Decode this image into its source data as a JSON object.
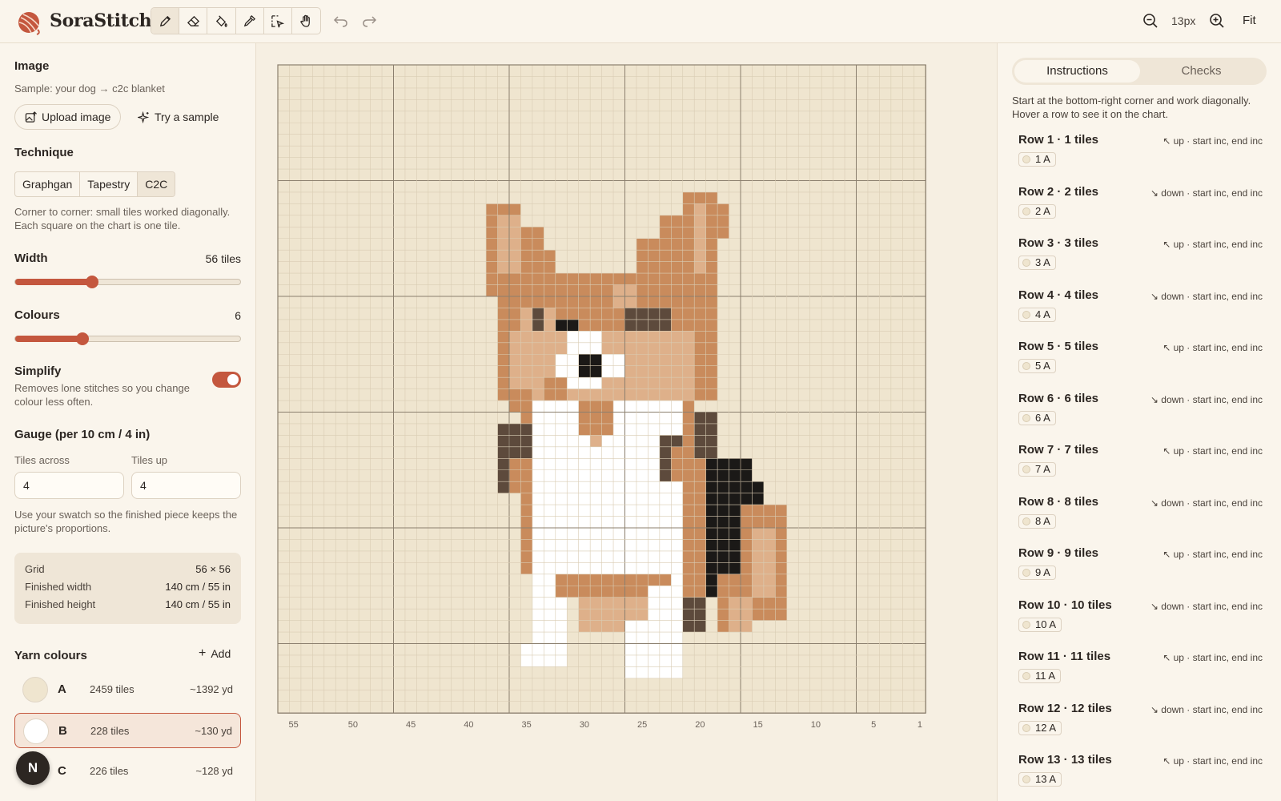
{
  "app": {
    "name": "SoraStitch",
    "logo_icon": "yarn-ball-icon"
  },
  "toolbar": {
    "tools": [
      {
        "name": "pencil-icon",
        "active": true
      },
      {
        "name": "eraser-icon",
        "active": false
      },
      {
        "name": "fill-bucket-icon",
        "active": false
      },
      {
        "name": "eyedropper-icon",
        "active": false
      },
      {
        "name": "select-icon",
        "active": false
      },
      {
        "name": "hand-icon",
        "active": false
      }
    ],
    "undo_icon": "undo-icon",
    "redo_icon": "redo-icon",
    "zoom_value": "13px",
    "fit_label": "Fit"
  },
  "sidebar": {
    "image": {
      "heading": "Image",
      "subtitle": "Sample: your dog → c2c blanket",
      "upload_label": "Upload image",
      "sample_label": "Try a sample"
    },
    "technique": {
      "heading": "Technique",
      "options": [
        "Graphgan",
        "Tapestry",
        "C2C"
      ],
      "selected": "C2C",
      "description": "Corner to corner: small tiles worked diagonally. Each square on the chart is one tile."
    },
    "width": {
      "label": "Width",
      "value": "56 tiles",
      "level": 0.34
    },
    "colours": {
      "label": "Colours",
      "value": "6",
      "level": 0.3
    },
    "simplify": {
      "label": "Simplify",
      "description": "Removes lone stitches so you change colour less often.",
      "enabled": true
    },
    "gauge": {
      "heading": "Gauge (per 10 cm / 4 in)",
      "across_label": "Tiles across",
      "across_value": "4",
      "up_label": "Tiles up",
      "up_value": "4",
      "note": "Use your swatch so the finished piece keeps the picture's proportions."
    },
    "summary": [
      {
        "label": "Grid",
        "value": "56 × 56"
      },
      {
        "label": "Finished width",
        "value": "140 cm / 55 in"
      },
      {
        "label": "Finished height",
        "value": "140 cm / 55 in"
      }
    ],
    "yarn": {
      "heading": "Yarn colours",
      "add_label": "Add",
      "items": [
        {
          "letter": "A",
          "tiles": "2459 tiles",
          "yards": "~1392 yd",
          "color": "#efe5cf",
          "selected": false
        },
        {
          "letter": "B",
          "tiles": "228 tiles",
          "yards": "~130 yd",
          "color": "#ffffff",
          "selected": true
        },
        {
          "letter": "C",
          "tiles": "226 tiles",
          "yards": "~128 yd",
          "color": "#c98b5c",
          "selected": false
        }
      ]
    },
    "user_initial": "N"
  },
  "chart": {
    "background": "#efe5cf",
    "x_tick_labels": [
      "55",
      "50",
      "45",
      "40",
      "35",
      "30",
      "25",
      "20",
      "15",
      "10",
      "5",
      "1"
    ],
    "palette": {
      "A": "#efe5cf",
      "B": "#ffffff",
      "C": "#c98b5c",
      "D": "#deb08a",
      "E": "#5d4a3c",
      "F": "#1b1917"
    }
  },
  "right": {
    "tabs": [
      "Instructions",
      "Checks"
    ],
    "active_tab": "Instructions",
    "intro": "Start at the bottom-right corner and work diagonally. Hover a row to see it on the chart.",
    "rows": [
      {
        "title": "Row 1 · 1 tiles",
        "dir": "↖ up · start inc, end inc",
        "chip": "1 A"
      },
      {
        "title": "Row 2 · 2 tiles",
        "dir": "↘ down · start inc, end inc",
        "chip": "2 A"
      },
      {
        "title": "Row 3 · 3 tiles",
        "dir": "↖ up · start inc, end inc",
        "chip": "3 A"
      },
      {
        "title": "Row 4 · 4 tiles",
        "dir": "↘ down · start inc, end inc",
        "chip": "4 A"
      },
      {
        "title": "Row 5 · 5 tiles",
        "dir": "↖ up · start inc, end inc",
        "chip": "5 A"
      },
      {
        "title": "Row 6 · 6 tiles",
        "dir": "↘ down · start inc, end inc",
        "chip": "6 A"
      },
      {
        "title": "Row 7 · 7 tiles",
        "dir": "↖ up · start inc, end inc",
        "chip": "7 A"
      },
      {
        "title": "Row 8 · 8 tiles",
        "dir": "↘ down · start inc, end inc",
        "chip": "8 A"
      },
      {
        "title": "Row 9 · 9 tiles",
        "dir": "↖ up · start inc, end inc",
        "chip": "9 A"
      },
      {
        "title": "Row 10 · 10 tiles",
        "dir": "↘ down · start inc, end inc",
        "chip": "10 A"
      },
      {
        "title": "Row 11 · 11 tiles",
        "dir": "↖ up · start inc, end inc",
        "chip": "11 A"
      },
      {
        "title": "Row 12 · 12 tiles",
        "dir": "↘ down · start inc, end inc",
        "chip": "12 A"
      },
      {
        "title": "Row 13 · 13 tiles",
        "dir": "↖ up · start inc, end inc",
        "chip": "13 A"
      }
    ]
  }
}
